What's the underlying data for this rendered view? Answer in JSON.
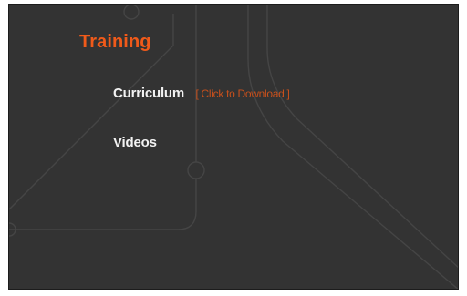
{
  "training": {
    "title": "Training",
    "items": [
      {
        "label": "Curriculum",
        "link_text": "[ Click to Download ]"
      },
      {
        "label": "Videos"
      }
    ]
  },
  "colors": {
    "background": "#333333",
    "accent": "#f05a1a",
    "link": "#c8501c",
    "text": "#f2f2f2"
  }
}
